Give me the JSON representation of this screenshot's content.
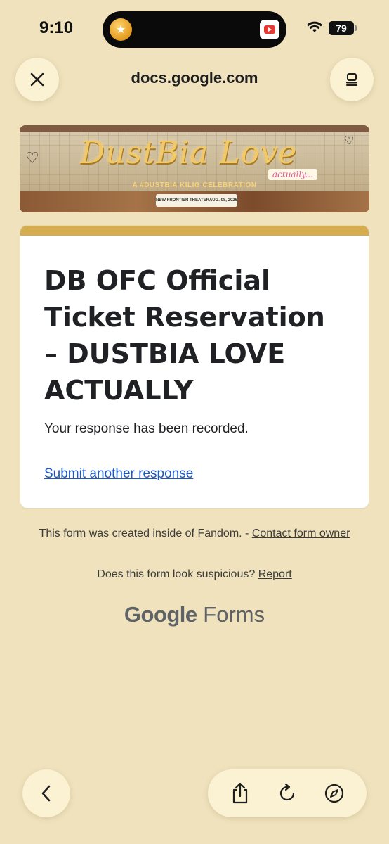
{
  "status_bar": {
    "time": "9:10",
    "battery": "79"
  },
  "browser": {
    "url": "docs.google.com"
  },
  "banner": {
    "title": "DustBia Love",
    "title_suffix": "actually...",
    "subtitle": "A #DUSTBIA KILIG CELEBRATION",
    "venue": "NEW FRONTIER THEATER",
    "date": "AUG. 08, 2026"
  },
  "form": {
    "title": "DB OFC Official Ticket Reservation – DUSTBIA LOVE ACTUALLY",
    "confirmation": "Your response has been recorded.",
    "submit_another": "Submit another response",
    "accent_color": "#d6ad4e"
  },
  "footer": {
    "created_text": "This form was created inside of Fandom. - ",
    "contact_link": "Contact form owner",
    "suspicious_text": "Does this form look suspicious? ",
    "report_link": "Report",
    "brand_google": "Google",
    "brand_forms": " Forms"
  },
  "icons": {
    "close": "close-icon",
    "tabs": "tabs-icon",
    "back": "chevron-left-icon",
    "share": "share-icon",
    "reload": "reload-icon",
    "compass": "compass-icon"
  }
}
